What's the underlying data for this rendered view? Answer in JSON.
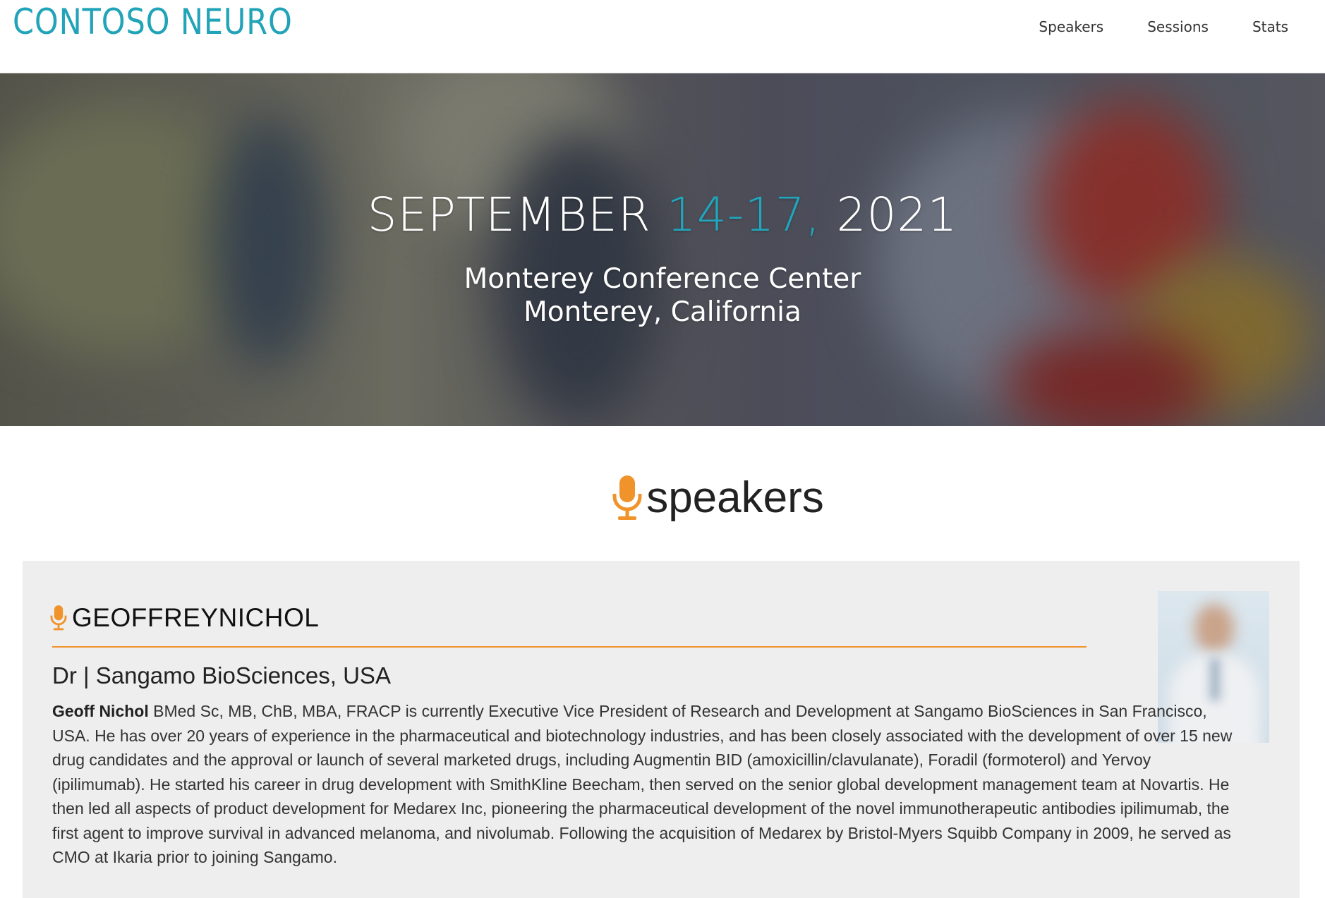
{
  "header": {
    "logo": "CONTOSO NEURO",
    "nav": [
      {
        "label": "Speakers"
      },
      {
        "label": "Sessions"
      },
      {
        "label": "Stats"
      }
    ]
  },
  "hero": {
    "month": "SEPTEMBER",
    "days": "14-17,",
    "year": "2021",
    "venue_line1": "Monterey Conference Center",
    "venue_line2": "Monterey, California"
  },
  "speakers_section": {
    "title": "speakers",
    "icon": "microphone-icon",
    "accent_color": "#f0932b"
  },
  "speaker": {
    "name": "GEOFFREYNICHOL",
    "role": "Dr | Sangamo BioSciences, USA",
    "bio_name": "Geoff Nichol",
    "bio_text": " BMed Sc, MB, ChB, MBA, FRACP is currently Executive Vice President of Research and Development at Sangamo BioSciences in San Francisco, USA. He has over 20 years of experience in the pharmaceutical and biotechnology industries, and has been closely associated with the development of over 15 new drug candidates and the approval or launch of several marketed drugs, including Augmentin BID (amoxicillin/clavulanate), Foradil (formoterol) and Yervoy (ipilimumab). He started his career in drug development with SmithKline Beecham, then served on the senior global development management team at Novartis. He then led all aspects of product development for Medarex Inc, pioneering the pharmaceutical development of the novel immunotherapeutic antibodies ipilimumab, the first agent to improve survival in advanced melanoma, and nivolumab. Following the acquisition of Medarex by Bristol-Myers Squibb Company in 2009, he served as CMO at Ikaria prior to joining Sangamo."
  },
  "colors": {
    "brand": "#21a3b8",
    "accent": "#f0932b",
    "card_bg": "#eeeeee"
  }
}
